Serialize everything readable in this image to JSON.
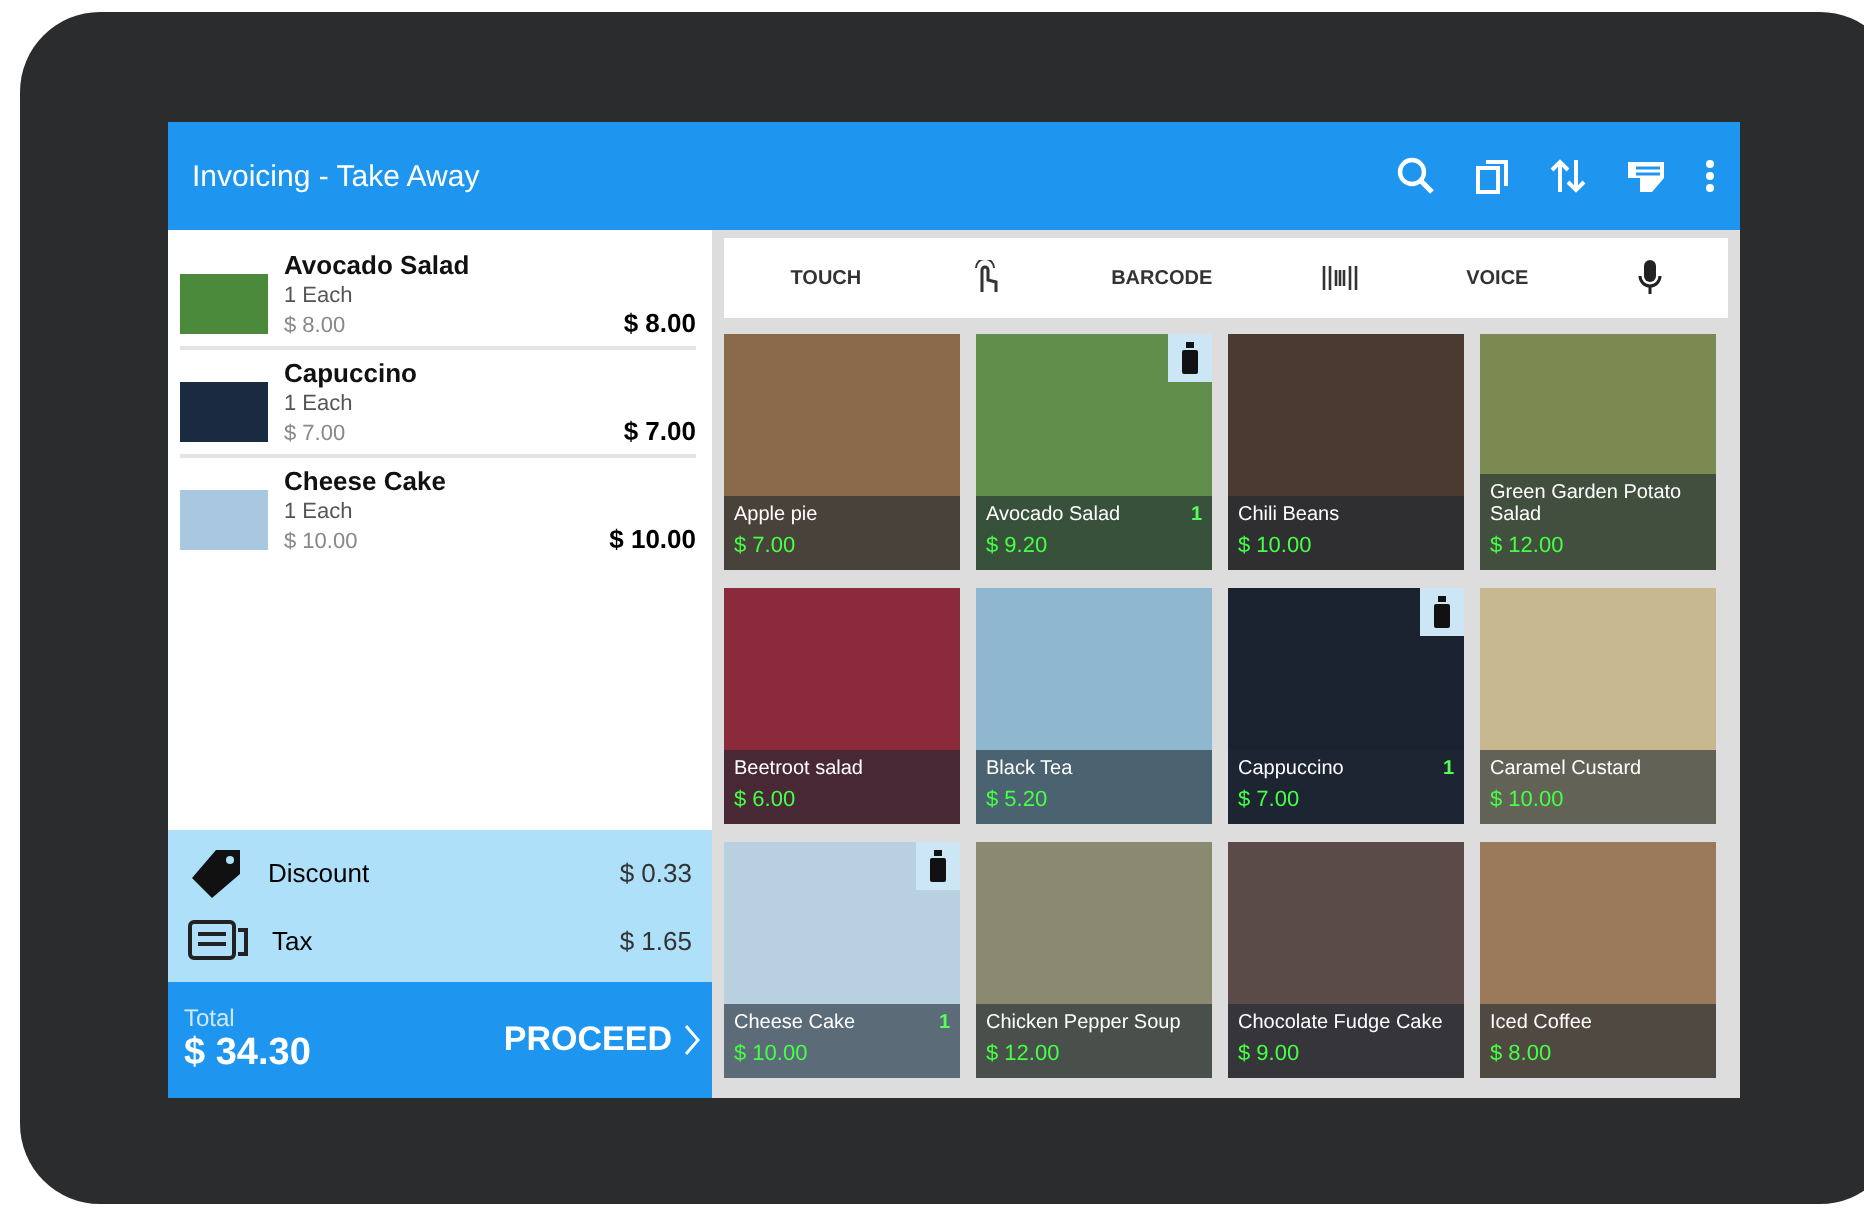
{
  "app_bar": {
    "title": "Invoicing - Take Away"
  },
  "cart": [
    {
      "name": "Avocado Salad",
      "quantity": "1 Each",
      "unit_price": "$ 8.00",
      "total": "$ 8.00"
    },
    {
      "name": "Capuccino",
      "quantity": "1 Each",
      "unit_price": "$ 7.00",
      "total": "$ 7.00"
    },
    {
      "name": "Cheese Cake",
      "quantity": "1 Each",
      "unit_price": "$ 10.00",
      "total": "$ 10.00"
    }
  ],
  "summary": [
    {
      "kind": "discount",
      "label": "Discount",
      "value": "$ 0.33"
    },
    {
      "kind": "tax",
      "label": "Tax",
      "value": "$ 1.65"
    }
  ],
  "total": {
    "label": "Total",
    "value": "$ 34.30",
    "button": "PROCEED"
  },
  "input_modes": [
    {
      "kind": "touch",
      "label": "TOUCH"
    },
    {
      "kind": "barcode",
      "label": "BARCODE"
    },
    {
      "kind": "voice",
      "label": "VOICE"
    }
  ],
  "products": [
    {
      "name": "Apple pie",
      "price": "$ 7.00",
      "tagged": false
    },
    {
      "name": "Avocado Salad",
      "price": "$ 9.20",
      "tagged": true,
      "count": "1"
    },
    {
      "name": "Chili Beans",
      "price": "$ 10.00",
      "tagged": false
    },
    {
      "name": "Green Garden Potato Salad",
      "price": "$ 12.00",
      "tagged": false
    },
    {
      "name": "Beetroot salad",
      "price": "$ 6.00",
      "tagged": false
    },
    {
      "name": "Black Tea",
      "price": "$ 5.20",
      "tagged": false
    },
    {
      "name": "Cappuccino",
      "price": "$ 7.00",
      "tagged": true,
      "count": "1"
    },
    {
      "name": "Caramel Custard",
      "price": "$ 10.00",
      "tagged": false
    },
    {
      "name": "Cheese Cake",
      "price": "$ 10.00",
      "tagged": true,
      "count": "1"
    },
    {
      "name": "Chicken Pepper Soup",
      "price": "$ 12.00",
      "tagged": false
    },
    {
      "name": "Chocolate Fudge Cake",
      "price": "$ 9.00",
      "tagged": false
    },
    {
      "name": "Iced Coffee",
      "price": "$ 8.00",
      "tagged": false
    }
  ]
}
